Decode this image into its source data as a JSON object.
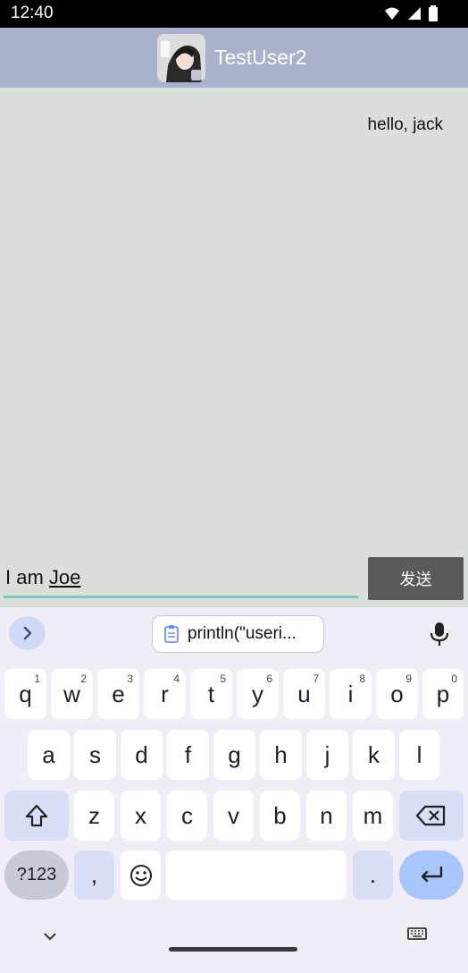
{
  "status": {
    "time": "12:40"
  },
  "header": {
    "title": "TestUser2"
  },
  "chat": {
    "message": "hello, jack"
  },
  "composer": {
    "text_prefix": "I am ",
    "text_underlined": "Joe",
    "send_label": "发送"
  },
  "keyboard": {
    "clipboard_text": "println(\"useri...",
    "row1": [
      {
        "label": "q",
        "sup": "1"
      },
      {
        "label": "w",
        "sup": "2"
      },
      {
        "label": "e",
        "sup": "3"
      },
      {
        "label": "r",
        "sup": "4"
      },
      {
        "label": "t",
        "sup": "5"
      },
      {
        "label": "y",
        "sup": "6"
      },
      {
        "label": "u",
        "sup": "7"
      },
      {
        "label": "i",
        "sup": "8"
      },
      {
        "label": "o",
        "sup": "9"
      },
      {
        "label": "p",
        "sup": "0"
      }
    ],
    "row2": [
      "a",
      "s",
      "d",
      "f",
      "g",
      "h",
      "j",
      "k",
      "l"
    ],
    "row3": [
      "z",
      "x",
      "c",
      "v",
      "b",
      "n",
      "m"
    ],
    "symbols_label": "?123",
    "comma_label": ",",
    "period_label": "."
  }
}
